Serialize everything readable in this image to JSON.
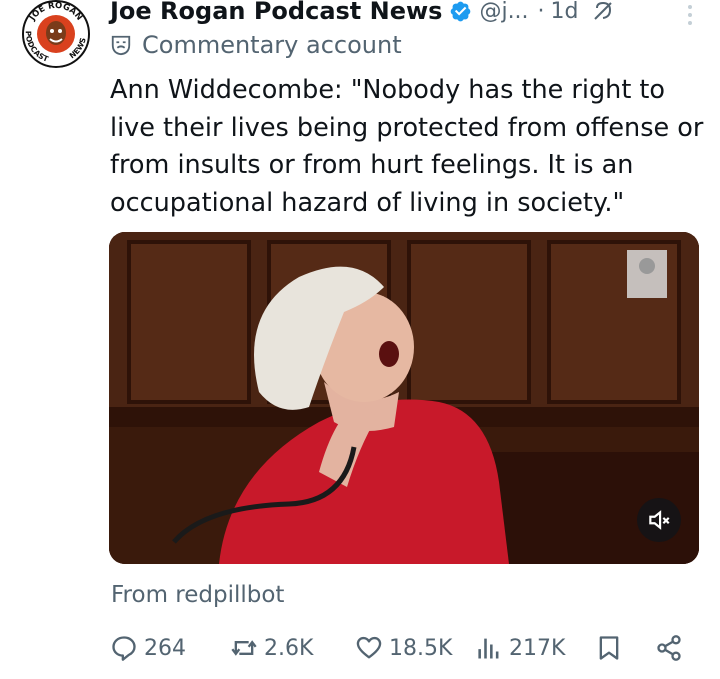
{
  "author": {
    "name": "Joe Rogan Podcast News",
    "handle": "@j...",
    "time_sep": "·",
    "time": "1d",
    "avatar_text_top": "JOE ROGAN",
    "avatar_text_left": "PODCAST",
    "avatar_text_right": "NEWS"
  },
  "commentary_label": "Commentary account",
  "tweet_text": "Ann Widdecombe: \"Nobody has the right to\nlive their lives being protected from offense or\nfrom insults or from hurt feelings. It is an\noccupational hazard of living in society.\"",
  "media": {
    "type": "video",
    "muted": true
  },
  "source": "From redpillbot",
  "actions": {
    "replies": "264",
    "reposts": "2.6K",
    "likes": "18.5K",
    "views": "217K"
  },
  "colors": {
    "text": "#0f1419",
    "secondary": "#536471",
    "verified": "#1d9bf0"
  },
  "icons": [
    "verified-badge-icon",
    "grok-icon",
    "more-icon",
    "commentary-mask-icon",
    "mute-icon",
    "reply-icon",
    "repost-icon",
    "like-icon",
    "views-icon",
    "bookmark-icon",
    "share-icon"
  ]
}
